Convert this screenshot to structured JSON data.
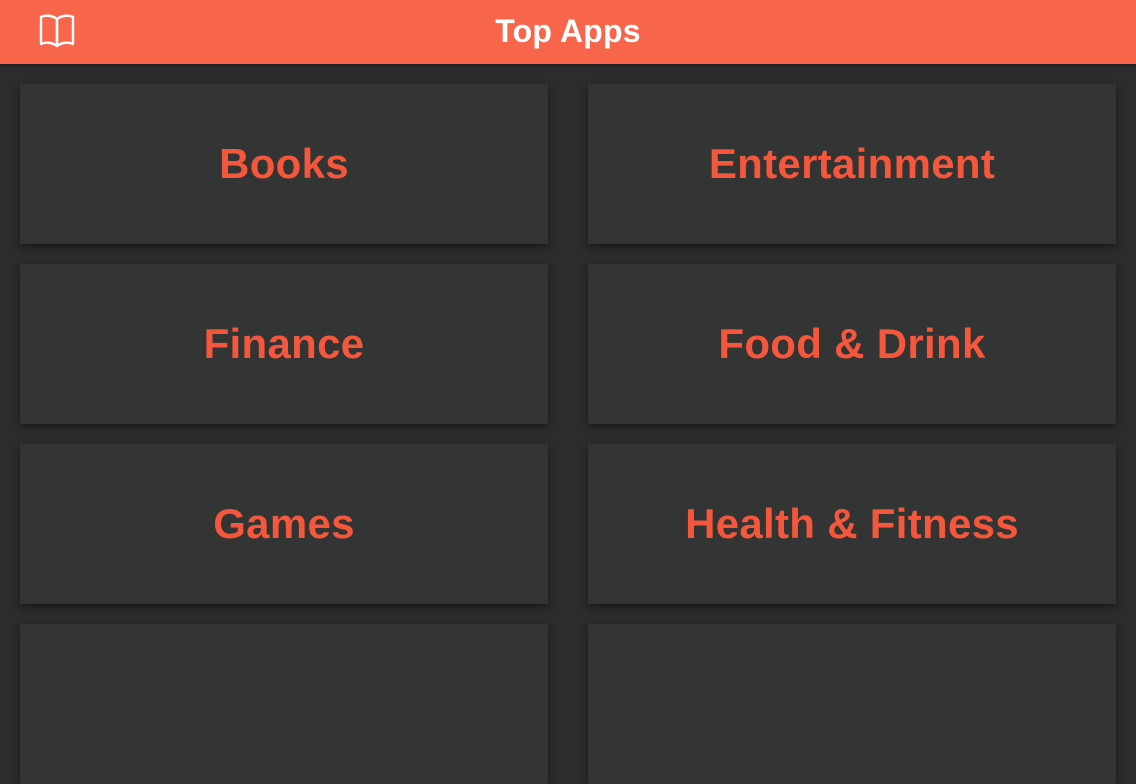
{
  "nav": {
    "title": "Top Apps",
    "left_icon": "book-icon"
  },
  "categories": [
    {
      "label": "Books"
    },
    {
      "label": "Entertainment"
    },
    {
      "label": "Finance"
    },
    {
      "label": "Food & Drink"
    },
    {
      "label": "Games"
    },
    {
      "label": "Health & Fitness"
    },
    {
      "label": ""
    },
    {
      "label": ""
    }
  ],
  "colors": {
    "nav_bar": "#f7654a",
    "background": "#2b2c2c",
    "tile": "#333434",
    "tile_text": "#f4573b",
    "title_text": "#ffffff"
  }
}
